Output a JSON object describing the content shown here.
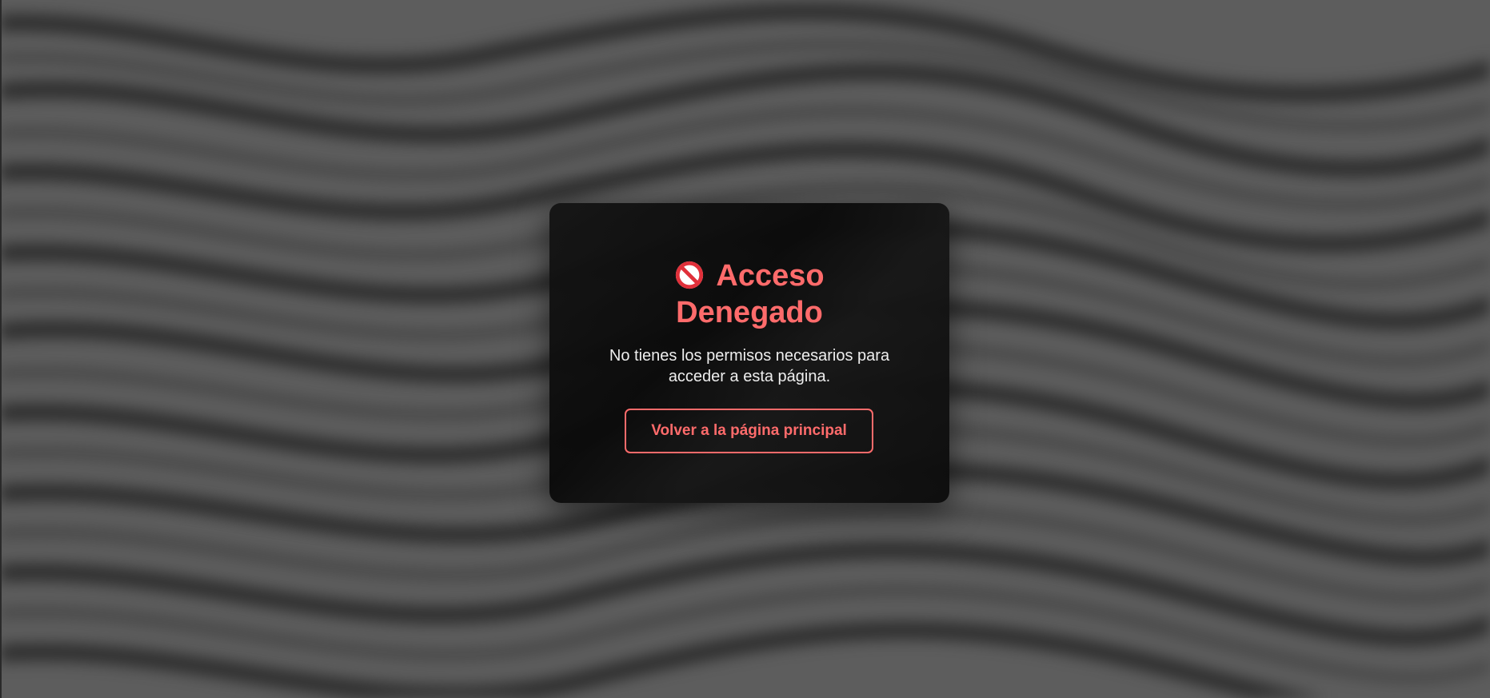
{
  "colors": {
    "accent": "#ff6b6b",
    "card_background": "#111111",
    "page_background": "#5d5d5d",
    "message_text": "#eeeeee"
  },
  "dialog": {
    "icon": "no-entry-icon",
    "title_line1": "Acceso",
    "title_line2": "Denegado",
    "message": "No tienes los permisos necesarios para acceder a esta página.",
    "button_label": "Volver a la página principal"
  }
}
